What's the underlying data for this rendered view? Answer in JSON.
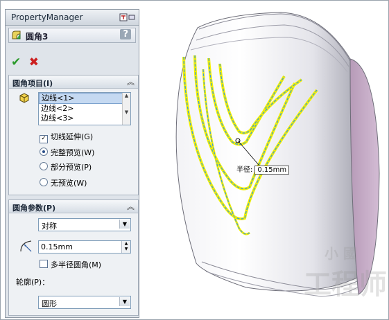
{
  "property_manager": {
    "title": "PropertyManager",
    "feature_name": "圆角3",
    "help": "?",
    "ok_symbol": "✔",
    "cancel_symbol": "✖",
    "fillet_items": {
      "header": "圆角项目(I)",
      "edges": [
        "边线<1>",
        "边线<2>",
        "边线<3>"
      ],
      "tangent_propagation": "切线延伸(G)",
      "preview_options": [
        "完整预览(W)",
        "部分预览(P)",
        "无预览(W)"
      ],
      "selected_preview": 0
    },
    "fillet_params": {
      "header": "圆角参数(P)",
      "type_value": "对称",
      "radius_value": "0.15mm",
      "multi_radius": "多半径圆角(M)",
      "profile_label": "轮廓(P)：",
      "profile_value": "圆形"
    }
  },
  "viewport": {
    "dimension_label": "半径:",
    "dimension_value": "0.15mm",
    "watermark_top": "小  國",
    "watermark_bottom": "工程师"
  },
  "colors": {
    "highlight_yellow": "#f4f000",
    "edge_blue": "#3a9ad9",
    "face_purple": "#c7abc8",
    "ok_green": "#2b9a2b",
    "cancel_red": "#cc2020"
  }
}
